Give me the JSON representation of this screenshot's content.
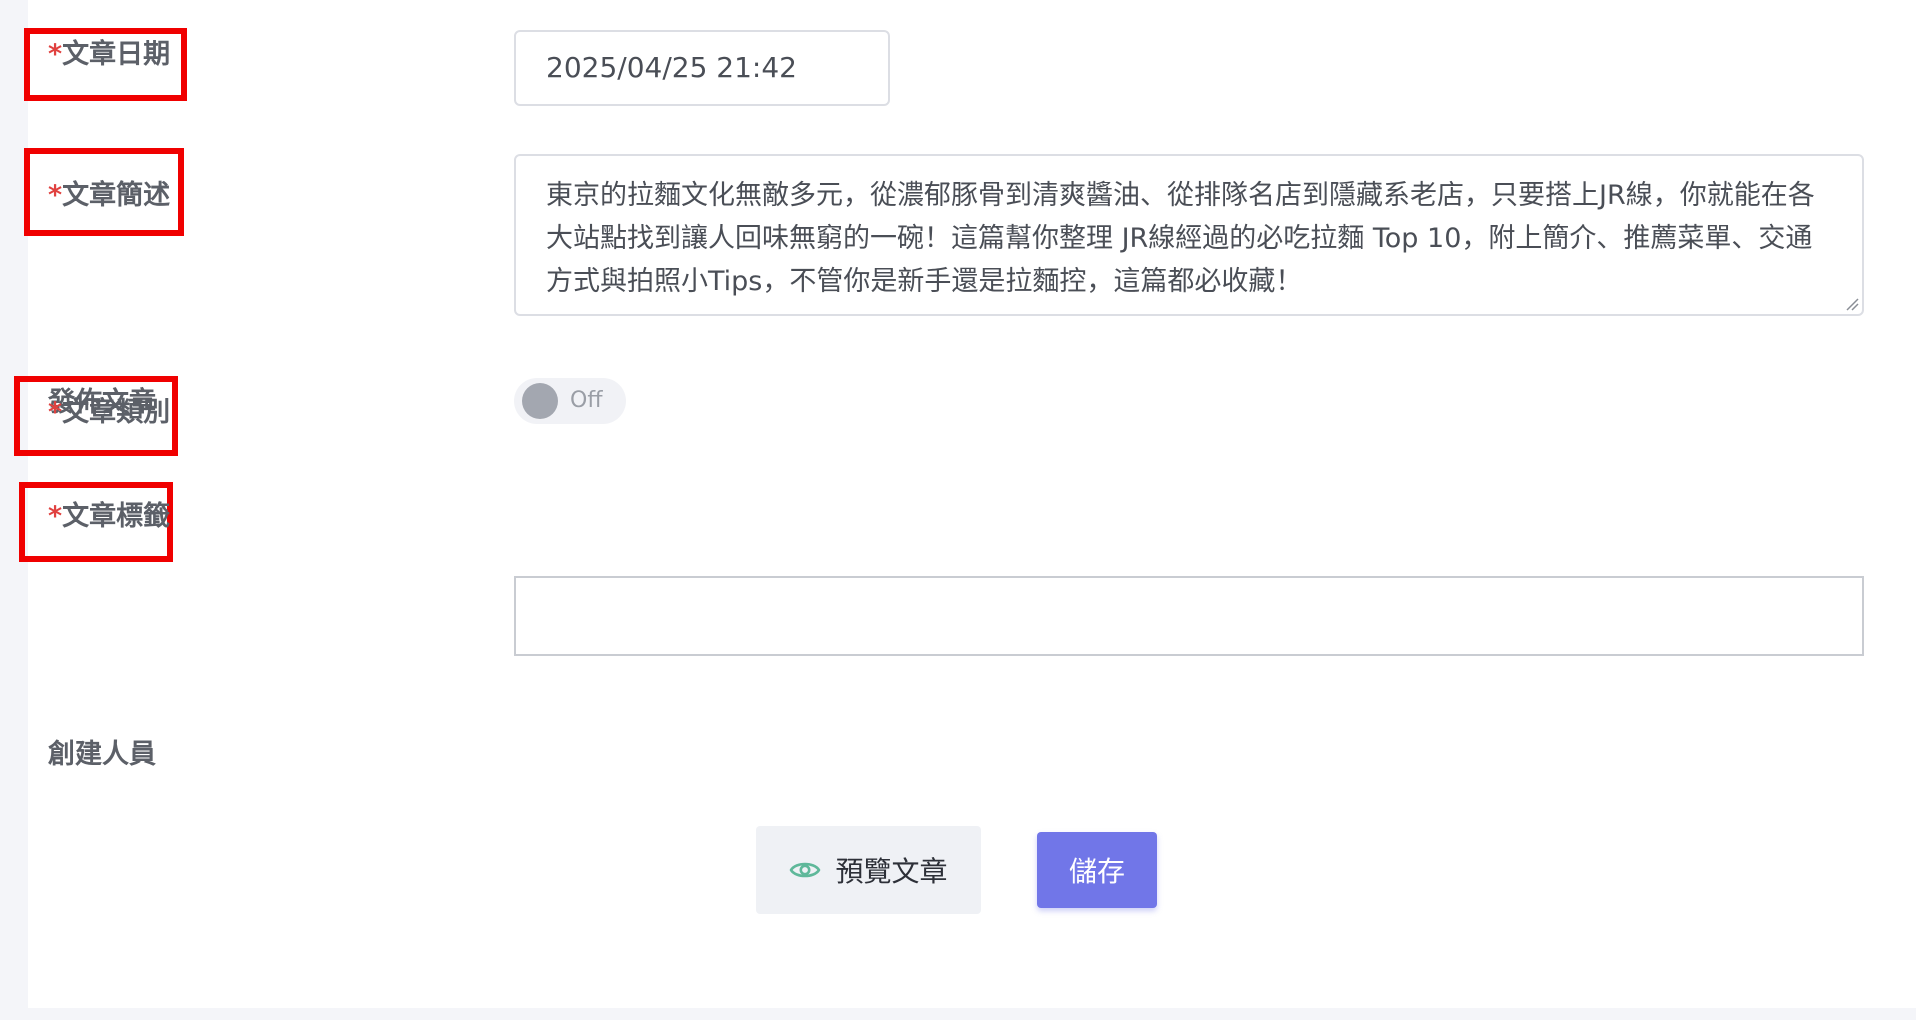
{
  "form": {
    "date": {
      "required_mark": "*",
      "label": "文章日期",
      "value": "2025/04/25 21:42"
    },
    "description": {
      "required_mark": "*",
      "label": "文章簡述",
      "value": "東京的拉麵文化無敵多元，從濃郁豚骨到清爽醬油、從排隊名店到隱藏系老店，只要搭上JR線，你就能在各大站點找到讓人回味無窮的一碗！這篇幫你整理 JR線經過的必吃拉麵 Top 10，附上簡介、推薦菜單、交通方式與拍照小Tips，不管你是新手還是拉麵控，這篇都必收藏！"
    },
    "publish": {
      "label": "發佈文章",
      "toggle_text": "Off",
      "enabled": false
    },
    "category": {
      "required_mark": "*",
      "label": "文章類別"
    },
    "tags": {
      "required_mark": "*",
      "label": "文章標籤",
      "value": ""
    },
    "creator": {
      "label": "創建人員"
    }
  },
  "actions": {
    "preview_label": "預覽文章",
    "preview_icon": "eye-icon",
    "save_label": "儲存"
  },
  "colors": {
    "required": "#e0413f",
    "highlight": "#f00000",
    "primary_button": "#7176e8",
    "preview_icon": "#5fb89a"
  }
}
